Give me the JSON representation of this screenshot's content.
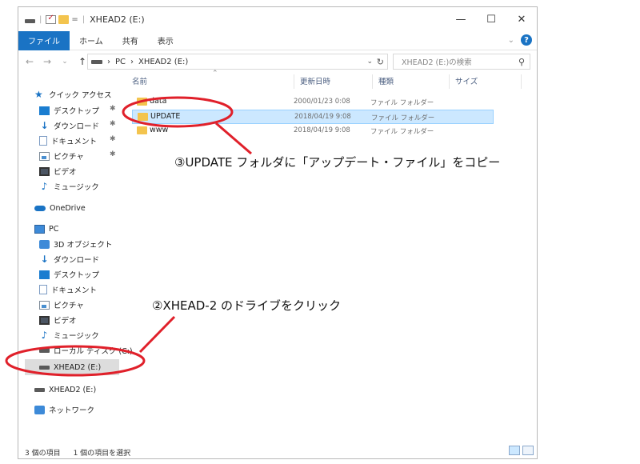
{
  "window": {
    "title": "XHEAD2 (E:)",
    "quick_access_separator": "=",
    "controls": [
      "—",
      "☐",
      "✕"
    ]
  },
  "ribbon": {
    "tabs": [
      "ファイル",
      "ホーム",
      "共有",
      "表示"
    ],
    "expand": "⌄",
    "help": "?"
  },
  "address_bar": {
    "nav": {
      "back": "←",
      "forward": "→",
      "recent": "⌄",
      "up": "↑"
    },
    "segments": [
      "PC",
      "XHEAD2 (E:)"
    ],
    "separator": "›",
    "dropdown": "⌄",
    "refresh": "↻"
  },
  "search": {
    "placeholder": "XHEAD2 (E:)の検索",
    "icon": "search-icon"
  },
  "nav_pane": {
    "quick_access": "クイック アクセス",
    "quick_items": [
      "デスクトップ",
      "ダウンロード",
      "ドキュメント",
      "ピクチャ",
      "ビデオ",
      "ミュージック"
    ],
    "onedrive": "OneDrive",
    "pc": "PC",
    "pc_items": [
      "3D オブジェクト",
      "ダウンロード",
      "デスクトップ",
      "ドキュメント",
      "ピクチャ",
      "ビデオ",
      "ミュージック",
      "ローカル ディスク (C:)"
    ],
    "selected_drive": "XHEAD2 (E:)",
    "drive": "XHEAD2 (E:)",
    "network": "ネットワーク"
  },
  "file_list": {
    "columns": [
      "名前",
      "更新日時",
      "種類",
      "サイズ"
    ],
    "rows": [
      {
        "name": "data",
        "date": "2000/01/23 0:08",
        "type": "ファイル フォルダー"
      },
      {
        "name": "UPDATE",
        "date": "2018/04/19 9:08",
        "type": "ファイル フォルダー"
      },
      {
        "name": "www",
        "date": "2018/04/19 9:08",
        "type": "ファイル フォルダー"
      }
    ]
  },
  "status_bar": {
    "item_count": "3 個の項目",
    "selected_count": "1 個の項目を選択"
  },
  "annotations": {
    "step3": "③UPDATE フォルダに「アップデート・ファイル」をコピー",
    "step2": "②XHEAD-2 のドライブをクリック",
    "color": "#e0202a"
  }
}
